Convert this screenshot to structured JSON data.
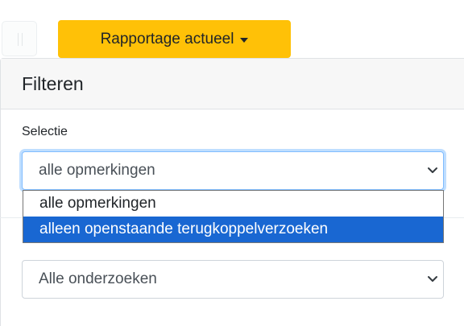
{
  "toolbar": {
    "report_button_label": "Rapportage actueel"
  },
  "filter_panel": {
    "title": "Filteren",
    "selection": {
      "label": "Selectie",
      "value": "alle opmerkingen",
      "options": [
        "alle opmerkingen",
        "alleen openstaande terugkoppelverzoeken"
      ],
      "highlighted_option": "alleen openstaande terugkoppelverzoeken"
    },
    "investigation": {
      "value": "Alle onderzoeken"
    }
  },
  "colors": {
    "report_button": "#ffc107",
    "focus_border": "#80bdff",
    "highlight_option": "#1967d2"
  },
  "icons": {
    "report_button_caret": "caret-down-icon",
    "select_chevron": "chevron-down-icon"
  }
}
